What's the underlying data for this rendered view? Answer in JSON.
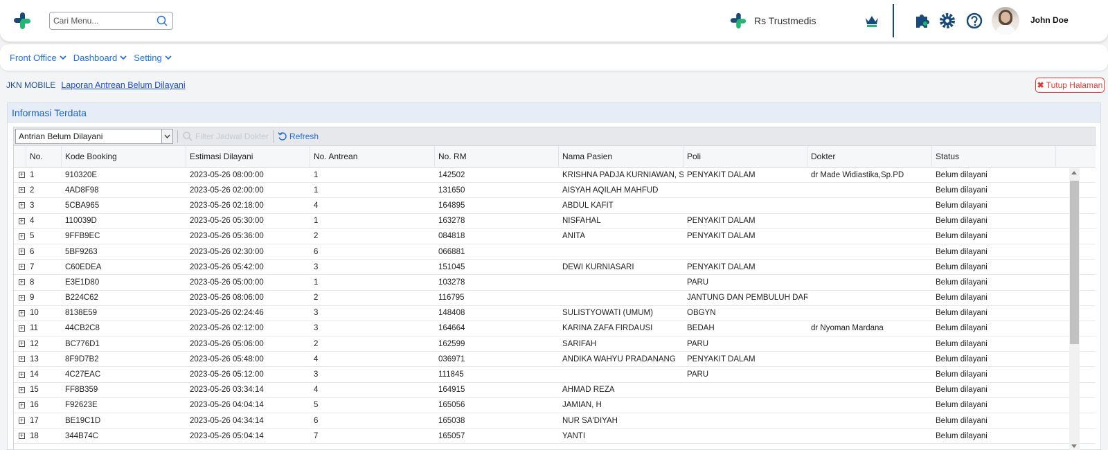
{
  "header": {
    "search_placeholder": "Cari Menu...",
    "hospital_name": "Rs Trustmedis",
    "user_name": "John Doe",
    "brand_colors": {
      "green": "#22b573",
      "navy": "#1a4a78"
    }
  },
  "menu": {
    "items": [
      {
        "label": "Front Office"
      },
      {
        "label": "Dashboard"
      },
      {
        "label": "Setting"
      }
    ]
  },
  "breadcrumb": {
    "root": "JKN MOBILE",
    "current": "Laporan Antrean Belum Dilayani",
    "close_label": "Tutup Halaman"
  },
  "panel": {
    "title": "Informasi Terdata",
    "filter_value": "Antrian Belum Dilayani",
    "search_button": "Filter Jadwal Dokter",
    "refresh_label": "Refresh"
  },
  "table": {
    "columns": [
      "No.",
      "Kode Booking",
      "Estimasi Dilayani",
      "No. Antrean",
      "No. RM",
      "Nama Pasien",
      "Poli",
      "Dokter",
      "Status"
    ],
    "rows": [
      [
        "1",
        "910320E",
        "2023-05-26 08:00:00",
        "1",
        "142502",
        "KRISHNA PADJA KURNIAWAN, SP",
        "PENYAKIT DALAM",
        "dr Made Widiastika,Sp.PD",
        "Belum dilayani"
      ],
      [
        "2",
        "4AD8F98",
        "2023-05-26 02:00:00",
        "1",
        "131650",
        "AISYAH AQILAH MAHFUD",
        "",
        "",
        "Belum dilayani"
      ],
      [
        "3",
        "5CBA965",
        "2023-05-26 02:18:00",
        "4",
        "164895",
        "ABDUL KAFIT",
        "",
        "",
        "Belum dilayani"
      ],
      [
        "4",
        "110039D",
        "2023-05-26 05:30:00",
        "1",
        "163278",
        "NISFAHAL",
        "PENYAKIT DALAM",
        "",
        "Belum dilayani"
      ],
      [
        "5",
        "9FFB9EC",
        "2023-05-26 05:36:00",
        "2",
        "084818",
        "ANITA",
        "PENYAKIT DALAM",
        "",
        "Belum dilayani"
      ],
      [
        "6",
        "5BF9263",
        "2023-05-26 02:30:00",
        "6",
        "066881",
        "",
        "",
        "",
        "Belum dilayani"
      ],
      [
        "7",
        "C60EDEA",
        "2023-05-26 05:42:00",
        "3",
        "151045",
        "DEWI KURNIASARI",
        "PENYAKIT DALAM",
        "",
        "Belum dilayani"
      ],
      [
        "8",
        "E3E1D80",
        "2023-05-26 05:00:00",
        "1",
        "103278",
        "",
        "PARU",
        "",
        "Belum dilayani"
      ],
      [
        "9",
        "B224C62",
        "2023-05-26 08:06:00",
        "2",
        "116795",
        "",
        "JANTUNG DAN PEMBULUH DAR...",
        "",
        "Belum dilayani"
      ],
      [
        "10",
        "8138E59",
        "2023-05-26 02:24:46",
        "3",
        "148408",
        "SULISTYOWATI (UMUM)",
        "OBGYN",
        "",
        "Belum dilayani"
      ],
      [
        "11",
        "44CB2C8",
        "2023-05-26 02:12:00",
        "3",
        "164664",
        "KARINA ZAFA FIRDAUSI",
        "BEDAH",
        "dr Nyoman Mardana",
        "Belum dilayani"
      ],
      [
        "12",
        "BC776D1",
        "2023-05-26 05:06:00",
        "2",
        "162599",
        "SARIFAH",
        "PARU",
        "",
        "Belum dilayani"
      ],
      [
        "13",
        "8F9D7B2",
        "2023-05-26 05:48:00",
        "4",
        "036971",
        "ANDIKA WAHYU PRADANANG",
        "PENYAKIT DALAM",
        "",
        "Belum dilayani"
      ],
      [
        "14",
        "4C27EAC",
        "2023-05-26 05:12:00",
        "3",
        "111845",
        "",
        "PARU",
        "",
        "Belum dilayani"
      ],
      [
        "15",
        "FF8B359",
        "2023-05-26 03:34:14",
        "4",
        "164915",
        "AHMAD REZA",
        "",
        "",
        "Belum dilayani"
      ],
      [
        "16",
        "F92623E",
        "2023-05-26 04:04:14",
        "5",
        "165056",
        "JAMIAN, H",
        "",
        "",
        "Belum dilayani"
      ],
      [
        "17",
        "BE19C1D",
        "2023-05-26 04:34:14",
        "6",
        "165038",
        "NUR SA'DIYAH",
        "",
        "",
        "Belum dilayani"
      ],
      [
        "18",
        "344B74C",
        "2023-05-26 05:04:14",
        "7",
        "165057",
        "YANTI",
        "",
        "",
        "Belum dilayani"
      ]
    ]
  }
}
